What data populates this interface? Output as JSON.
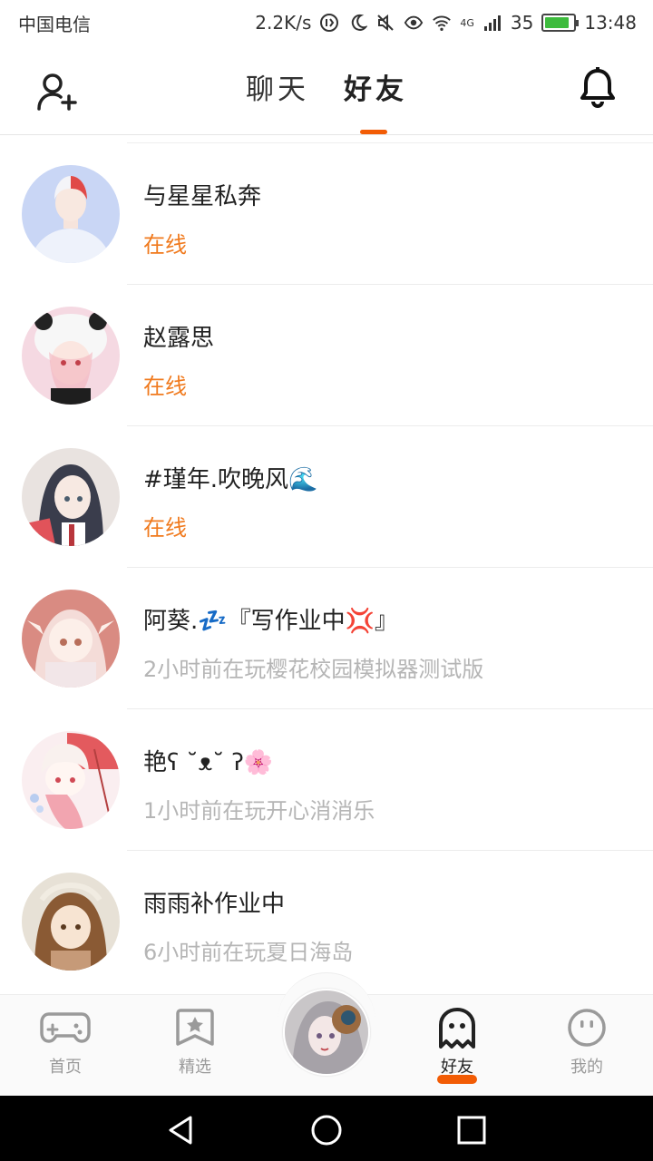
{
  "status_bar": {
    "carrier": "中国电信",
    "speed": "2.2K/s",
    "network": "4G",
    "signal_percent": "35",
    "time": "13:48",
    "battery_level": 0.85,
    "battery_color": "#3dbb3d"
  },
  "header": {
    "tabs": [
      {
        "label": "聊天",
        "active": false
      },
      {
        "label": "好友",
        "active": true
      }
    ],
    "accent": "#f25c05"
  },
  "friends": [
    {
      "name": "与星星私奔",
      "status": "在线",
      "status_type": "online"
    },
    {
      "name": "赵露思",
      "status": "在线",
      "status_type": "online"
    },
    {
      "name": "#瑾年.吹晚风🌊",
      "status": "在线",
      "status_type": "online"
    },
    {
      "name": "阿葵.💤『写作业中💢』",
      "status": "2小时前在玩樱花校园模拟器测试版",
      "status_type": "playing"
    },
    {
      "name": "艳ʕ ˘ᴥ˘ ʔ🌸",
      "status": "1小时前在玩开心消消乐",
      "status_type": "playing"
    },
    {
      "name": "雨雨补作业中",
      "status": "6小时前在玩夏日海岛",
      "status_type": "playing"
    }
  ],
  "bottom_nav": {
    "items": [
      {
        "label": "首页",
        "icon": "gamepad-icon"
      },
      {
        "label": "精选",
        "icon": "star-bookmark-icon"
      },
      {
        "label": "好友",
        "icon": "ghost-icon",
        "active": true
      },
      {
        "label": "我的",
        "icon": "smiley-face-icon"
      }
    ]
  },
  "colors": {
    "online": "#f07a1e",
    "offline": "#b5b5b5"
  }
}
